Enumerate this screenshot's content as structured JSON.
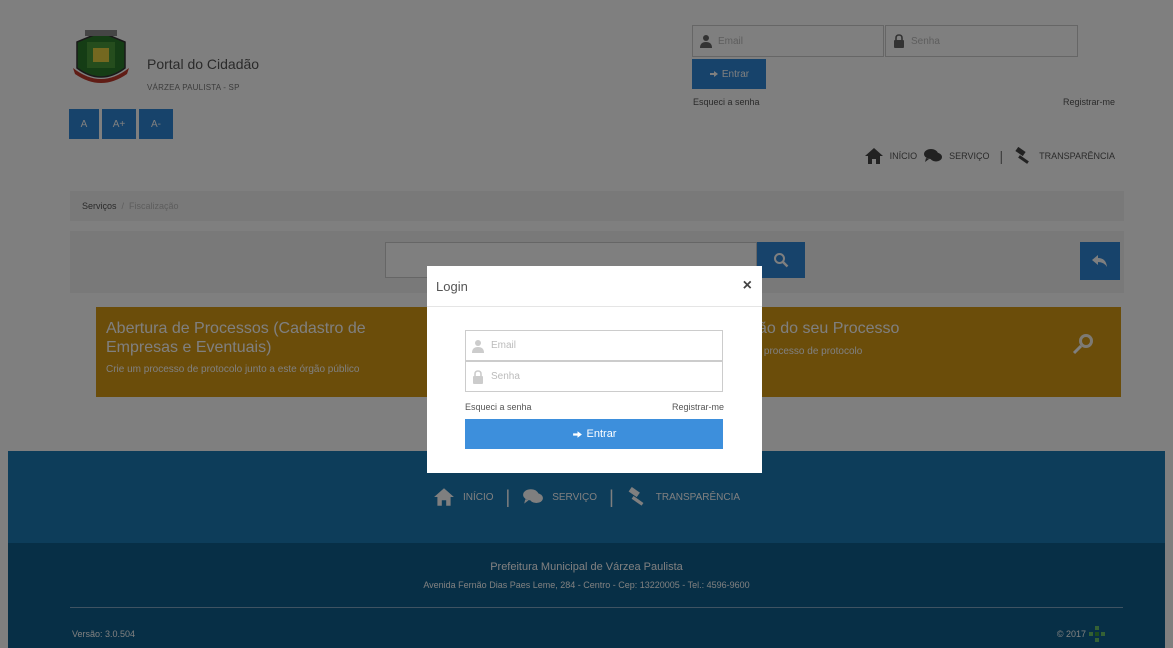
{
  "header": {
    "brand_title": "Portal do Cidadão",
    "brand_subtitle": "VÁRZEA PAULISTA - SP",
    "font_buttons": [
      "A",
      "A+",
      "A-"
    ],
    "email_placeholder": "Email",
    "senha_placeholder": "Senha",
    "entrar_label": "Entrar",
    "esqueci_label": "Esqueci a senha",
    "registrar_label": "Registrar-me"
  },
  "nav": {
    "inicio": "INÍCIO",
    "servico": "SERVIÇO",
    "transparencia": "TRANSPARÊNCIA",
    "separator": "|"
  },
  "breadcrumb": {
    "items": [
      "Serviços",
      "Fiscalização"
    ],
    "separator": "/"
  },
  "banner": {
    "left_title": "Abertura de Processos (Cadastro de Empresas e Eventuais)",
    "left_desc": "Crie um processo de protocolo junto a este órgão público",
    "right_title": "ção do seu Processo",
    "right_desc": "do processo de protocolo"
  },
  "footer": {
    "org_name": "Prefeitura Municipal de Várzea Paulista",
    "address": "Avenida Fernão Dias Paes Leme, 284 - Centro - Cep: 13220005 - Tel.: 4596-9600",
    "version": "Versão: 3.0.504",
    "copyright": "© 2017"
  },
  "modal": {
    "title": "Login",
    "close": "×",
    "email_placeholder": "Email",
    "senha_placeholder": "Senha",
    "esqueci_label": "Esqueci a senha",
    "registrar_label": "Registrar-me",
    "entrar_label": "Entrar"
  },
  "colors": {
    "primary": "#2e86d6",
    "banner": "#d79a14",
    "footer_nav": "#1a7ab5",
    "footer_bottom": "#0f5f8c",
    "overlay": "rgba(0,0,0,0.5)"
  }
}
